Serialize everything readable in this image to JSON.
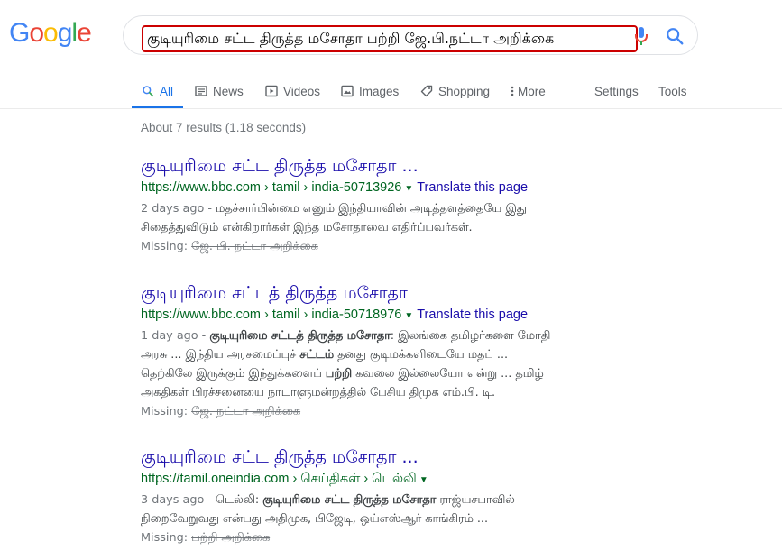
{
  "logo": "Google",
  "search": {
    "query": "குடியுரிமை சட்ட திருத்த மசோதா பற்றி ஜே.பி.நட்டா அறிக்கை"
  },
  "tabs": [
    {
      "label": "All"
    },
    {
      "label": "News"
    },
    {
      "label": "Videos"
    },
    {
      "label": "Images"
    },
    {
      "label": "Shopping"
    },
    {
      "label": "More"
    },
    {
      "label": "Settings"
    },
    {
      "label": "Tools"
    }
  ],
  "stats": "About 7 results (1.18 seconds)",
  "results": [
    {
      "title": "குடியுரிமை சட்ட திருத்த மசோதா ...",
      "url": "https://www.bbc.com › tamil › india-50713926",
      "translate": "Translate this page",
      "date": "2 days ago - ",
      "snippet_1": "மதச்சார்பின்மை எனும் இந்தியாவின் அடித்தளத்தையே இது",
      "snippet_2": "சிதைத்துவிடும் என்கிறார்கள் இந்த மசோதாவை எதிர்ப்பவர்கள்.",
      "missing_label": "Missing:",
      "missing_terms": "ஜே. பி. நட்டா அறிக்கை"
    },
    {
      "title": "குடியுரிமை சட்டத் திருத்த மசோதா",
      "url": "https://www.bbc.com › tamil › india-50718976",
      "translate": "Translate this page",
      "date": "1 day ago - ",
      "s1_bold": "குடியுரிமை சட்டத் திருத்த மசோதா",
      "s1_rest": ": இலங்கை தமிழர்களை மோதி",
      "s2_a": "அரசு ... இந்திய அரசமைப்புச் ",
      "s2_bold": "சட்டம்",
      "s2_b": " தனது குடிமக்களிடையே மதப் ...",
      "s3_a": "தெற்கிலே இருக்கும் இந்துக்களைப் ",
      "s3_bold": "பற்றி",
      "s3_b": " கவலை இல்லையோ என்று ... தமிழ்",
      "s4": "அகதிகள் பிரச்சனையை நாடாளுமன்றத்தில் பேசிய திமுக எம்.பி. டி.",
      "missing_label": "Missing:",
      "missing_terms": "ஜே. நட்டா அறிக்கை"
    },
    {
      "title": "குடியுரிமை சட்ட திருத்த மசோதா ...",
      "url": "https://tamil.oneindia.com › செய்திகள் › டெல்லி",
      "date": "3 days ago - ",
      "s1_a": "டெல்லி: ",
      "s1_bold": "குடியுரிமை சட்ட திருத்த மசோதா",
      "s1_b": " ராஜ்யசபாவில்",
      "s2": "நிறைவேறுவது என்பது அதிமுக, பிஜேடி, ஒய்எஸ்ஆர் காங்கிரம் ...",
      "missing_label": "Missing:",
      "missing_terms": "பற்றி அறிக்கை"
    }
  ],
  "colors": {
    "link": "#1a0dab",
    "url": "#006621",
    "accent": "#1a73e8",
    "highlight_border": "#cc0000"
  }
}
